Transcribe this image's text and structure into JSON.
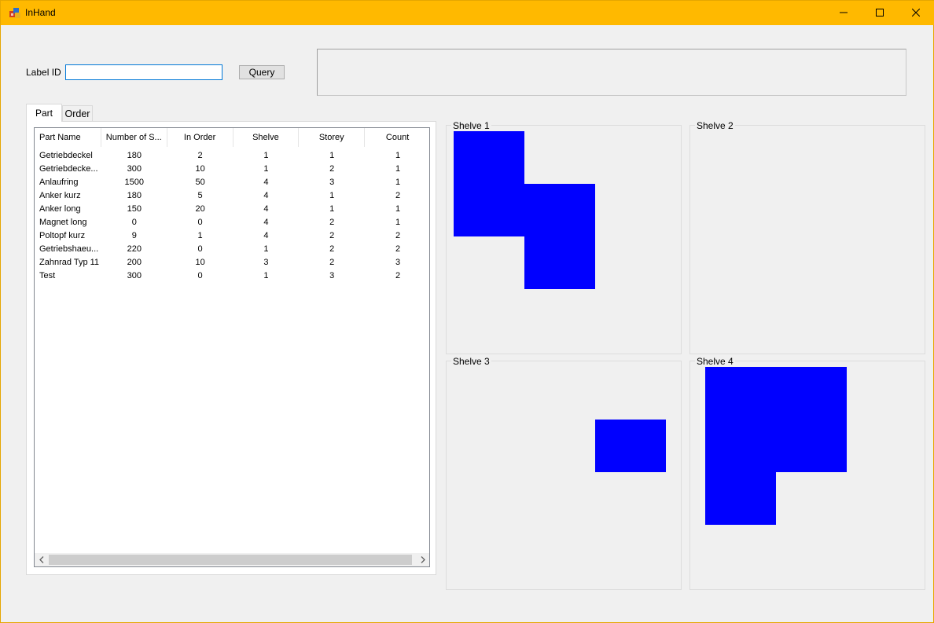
{
  "window": {
    "title": "InHand",
    "controls": {
      "minimize_icon": "minimize-icon",
      "maximize_icon": "maximize-icon",
      "close_icon": "close-icon"
    }
  },
  "query": {
    "label": "Label ID",
    "input_value": "",
    "button_label": "Query"
  },
  "message": {
    "text": ""
  },
  "tabs": [
    {
      "label": "Part",
      "selected": true
    },
    {
      "label": "Order",
      "selected": false
    }
  ],
  "table": {
    "columns": [
      "Part Name",
      "Number of S...",
      "In Order",
      "Shelve",
      "Storey",
      "Count"
    ],
    "rows": [
      [
        "Getriebdeckel",
        "180",
        "2",
        "1",
        "1",
        "1"
      ],
      [
        "Getriebdecke...",
        "300",
        "10",
        "1",
        "2",
        "1"
      ],
      [
        "Anlaufring",
        "1500",
        "50",
        "4",
        "3",
        "1"
      ],
      [
        "Anker kurz",
        "180",
        "5",
        "4",
        "1",
        "2"
      ],
      [
        "Anker long",
        "150",
        "20",
        "4",
        "1",
        "1"
      ],
      [
        "Magnet long",
        "0",
        "0",
        "4",
        "2",
        "1"
      ],
      [
        "Poltopf kurz",
        "9",
        "1",
        "4",
        "2",
        "2"
      ],
      [
        "Getriebshaeu...",
        "220",
        "0",
        "1",
        "2",
        "2"
      ],
      [
        "Zahnrad Typ 11",
        "200",
        "10",
        "3",
        "2",
        "3"
      ],
      [
        "Test",
        "300",
        "0",
        "1",
        "3",
        "2"
      ]
    ]
  },
  "shelves": [
    {
      "label": "Shelve 1"
    },
    {
      "label": "Shelve 2"
    },
    {
      "label": "Shelve 3"
    },
    {
      "label": "Shelve 4"
    }
  ],
  "colors": {
    "titlebar": "#ffb900",
    "occupied_cell": "#0000ff",
    "background": "#f0f0f0"
  }
}
